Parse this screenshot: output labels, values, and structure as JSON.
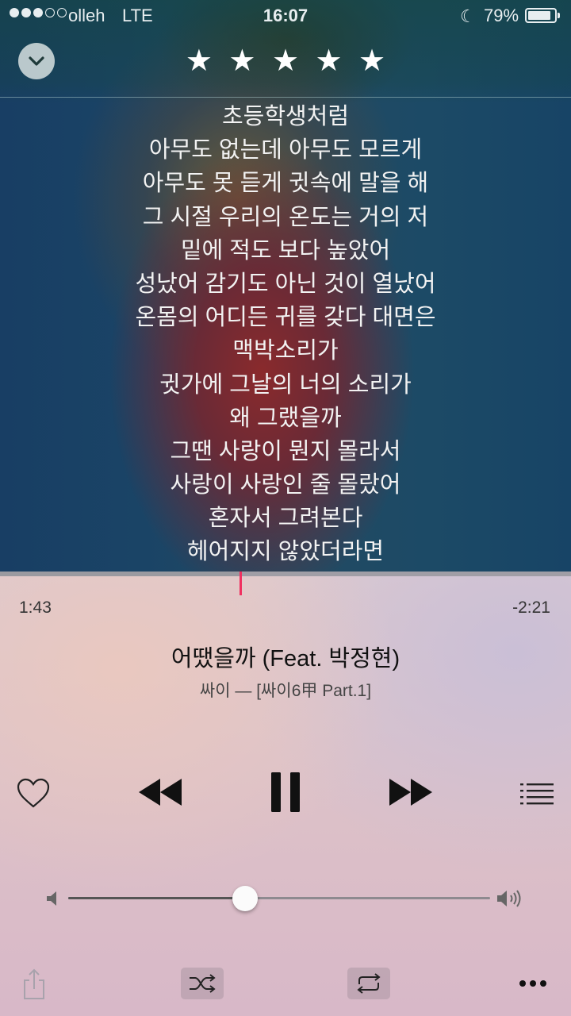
{
  "status_bar": {
    "signal_bars_filled": 3,
    "signal_bars_total": 5,
    "carrier": "olleh",
    "network": "LTE",
    "time": "16:07",
    "battery_percent": "79%"
  },
  "header": {
    "rating_stars": 5
  },
  "lyrics": [
    "초등학생처럼",
    "아무도 없는데 아무도 모르게",
    "아무도 못 듣게 귓속에 말을 해",
    "그 시절 우리의 온도는 거의 저",
    "밑에 적도 보다 높았어",
    "성났어 감기도 아닌 것이 열났어",
    "온몸의 어디든 귀를 갖다 대면은",
    "맥박소리가",
    "귓가에 그날의 너의 소리가",
    "왜 그랬을까",
    "그땐 사랑이 뭔지 몰라서",
    "사랑이 사랑인 줄 몰랐어",
    "혼자서 그려본다",
    "헤어지지 않았더라면"
  ],
  "playback": {
    "elapsed": "1:43",
    "remaining": "-2:21",
    "progress_fraction": 0.42
  },
  "track": {
    "title": "어땠을까 (Feat. 박정현)",
    "subtitle": "싸이 — [싸이6甲 Part.1]"
  },
  "volume": {
    "level_fraction": 0.42
  },
  "colors": {
    "playhead": "#f03060",
    "text_dark": "#111111",
    "lyrics_text": "#f2f2f2"
  },
  "icons": {
    "collapse": "chevron-down-icon",
    "rating": "star-icon",
    "favorite": "heart-icon",
    "rewind": "rewind-icon",
    "pause": "pause-icon",
    "forward": "fast-forward-icon",
    "queue": "list-icon",
    "volume_low": "speaker-low-icon",
    "volume_high": "speaker-high-icon",
    "share": "share-icon",
    "shuffle": "shuffle-icon",
    "repeat": "repeat-icon",
    "more": "more-icon"
  }
}
